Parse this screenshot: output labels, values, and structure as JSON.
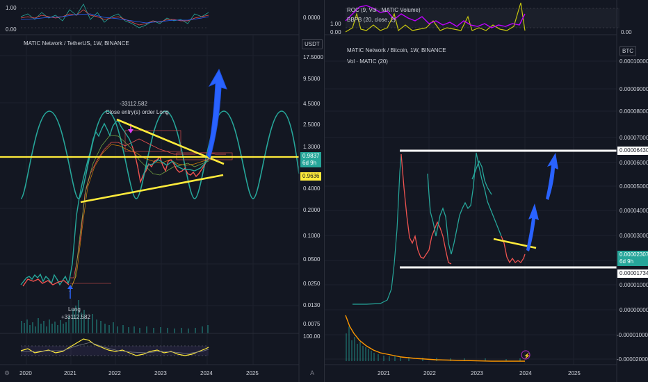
{
  "left_panel": {
    "top_indicator": {
      "ticks": [
        "1.00",
        "0.00"
      ],
      "value_tag": "0.0000"
    },
    "legend": "MATIC Network / TetherUS, 1W, BINANCE",
    "currency": "USDT",
    "price_axis": [
      "17.5000",
      "9.5000",
      "4.5000",
      "2.5000",
      "1.3000",
      "0.4000",
      "0.2000",
      "0.1000",
      "0.0500",
      "0.0250",
      "0.0130",
      "0.0075"
    ],
    "price_tag": {
      "value": "0.9837",
      "countdown": "6d 9h",
      "color": "#26a69a"
    },
    "line_tag": {
      "value": "0.9636",
      "color": "#ffeb3b"
    },
    "annotations": {
      "close_value": "-33112.582",
      "close_text": "Close entry(s) order Long",
      "long_text": "Long",
      "long_value": "+33112.582"
    },
    "bottom_indicator": {
      "tick": "100.00"
    },
    "time_axis": [
      "2020",
      "2021",
      "2022",
      "2023",
      "2024",
      "2025"
    ]
  },
  "right_panel": {
    "top_indicator": {
      "legend_1": "ROC (9, Vol · MATIC Volume)",
      "legend_2": "BBPB (20, close, 2)",
      "ticks": [
        "1.00",
        "0.00"
      ],
      "value_tag": "0.00"
    },
    "legend": "MATIC Network / Bitcoin, 1W, BINANCE",
    "volume_legend": "Vol · MATIC (20)",
    "currency": "BTC",
    "price_axis": [
      "0.00010000",
      "0.00009000",
      "0.00008000",
      "0.00007000",
      "0.00006000",
      "0.00005000",
      "0.00004000",
      "0.00003000",
      "0.00002000",
      "0.00001000",
      "0.00000000",
      "-0.00001000",
      "-0.00002000"
    ],
    "resistance_tag": "0.00006430",
    "price_tag": {
      "value": "0.00002307",
      "countdown": "6d 9h",
      "color": "#26a69a"
    },
    "support_tag": "0.00001734",
    "time_axis": [
      "2021",
      "2022",
      "2023",
      "2024",
      "2025"
    ]
  },
  "colors": {
    "background": "#131722",
    "yellow": "#ffeb3b",
    "green": "#26a69a",
    "red": "#ef5350",
    "blue": "#2962ff",
    "teal_wave": "#26a69a",
    "orange": "#ff9800",
    "purple": "#9c27b0"
  },
  "icons": [
    "arrow-up-icon",
    "gear-icon"
  ]
}
